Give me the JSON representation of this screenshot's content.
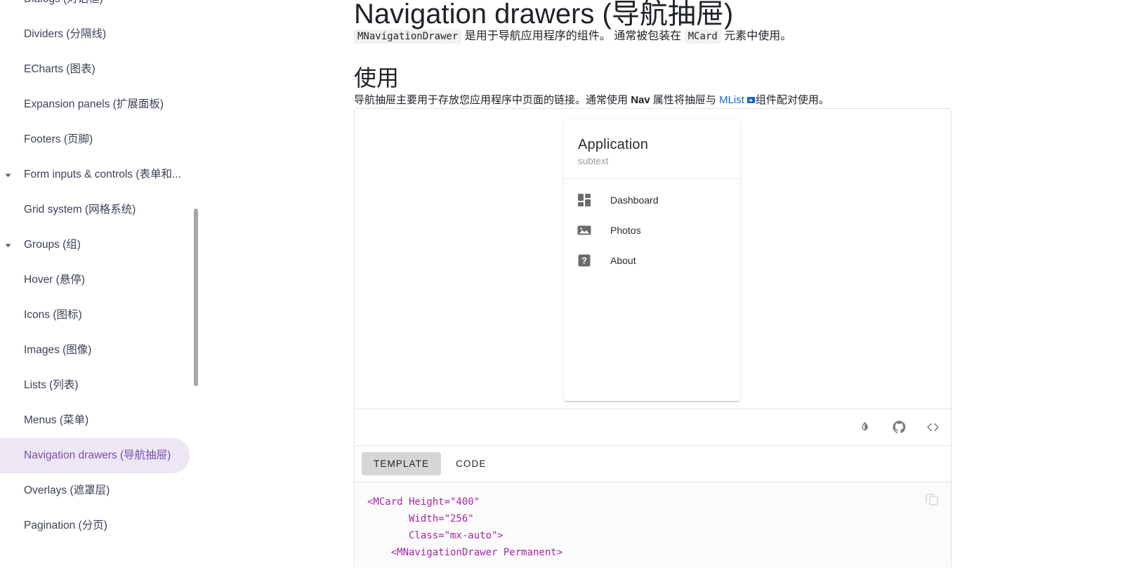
{
  "sidebar": {
    "items": [
      {
        "label": "Dialogs (对话框)",
        "expandable": false,
        "active": false,
        "clipped": true
      },
      {
        "label": "Dividers (分隔线)",
        "expandable": false,
        "active": false
      },
      {
        "label": "ECharts (图表)",
        "expandable": false,
        "active": false
      },
      {
        "label": "Expansion panels (扩展面板)",
        "expandable": false,
        "active": false
      },
      {
        "label": "Footers (页脚)",
        "expandable": false,
        "active": false
      },
      {
        "label": "Form inputs & controls (表单和...",
        "expandable": true,
        "active": false
      },
      {
        "label": "Grid system (网格系统)",
        "expandable": false,
        "active": false
      },
      {
        "label": "Groups (组)",
        "expandable": true,
        "active": false
      },
      {
        "label": "Hover (悬停)",
        "expandable": false,
        "active": false
      },
      {
        "label": "Icons (图标)",
        "expandable": false,
        "active": false
      },
      {
        "label": "Images (图像)",
        "expandable": false,
        "active": false
      },
      {
        "label": "Lists (列表)",
        "expandable": false,
        "active": false
      },
      {
        "label": "Menus (菜单)",
        "expandable": false,
        "active": false
      },
      {
        "label": "Navigation drawers (导航抽屉)",
        "expandable": false,
        "active": true
      },
      {
        "label": "Overlays (遮罩层)",
        "expandable": false,
        "active": false
      },
      {
        "label": "Pagination (分页)",
        "expandable": false,
        "active": false
      }
    ],
    "active_color": "#7b4fae",
    "active_background": "#ece6f5"
  },
  "main": {
    "intro": {
      "code_1": "MNavigationDrawer",
      "text_1": "是用于导航应用程序的组件。",
      "text_2": "通常被包装在",
      "code_2": "MCard",
      "text_3": "元素中使用。"
    },
    "section_title": "使用",
    "usage": {
      "text_1": "导航抽屉主要用于存放您应用程序中页面的链接。通常使用",
      "bold_1": "Nav",
      "text_2": "属性将抽屉与",
      "link": "MList",
      "text_3": "组件配对使用。",
      "link_color": "#1668c1"
    }
  },
  "demo": {
    "drawer": {
      "title": "Application",
      "subtitle": "subtext",
      "items": [
        {
          "label": "Dashboard",
          "icon": "dashboard-icon"
        },
        {
          "label": "Photos",
          "icon": "image-icon"
        },
        {
          "label": "About",
          "icon": "help-icon"
        }
      ]
    },
    "toolbar": [
      {
        "name": "theme-toggle-icon",
        "title": "Toggle theme"
      },
      {
        "name": "github-icon",
        "title": "View on GitHub"
      },
      {
        "name": "code-icon",
        "title": "View source"
      }
    ],
    "tabs": [
      {
        "label": "TEMPLATE",
        "active": true
      },
      {
        "label": "CODE",
        "active": false
      }
    ],
    "code": "<MCard Height=\"400\"\n       Width=\"256\"\n       Class=\"mx-auto\">\n    <MNavigationDrawer Permanent>",
    "code_color": "#a626a4",
    "copy_icon": "copy-icon"
  }
}
